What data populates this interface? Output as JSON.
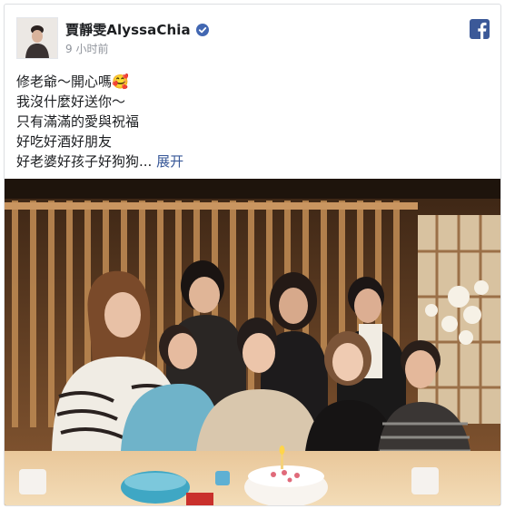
{
  "post": {
    "author": "賈靜雯AlyssaChia",
    "timestamp": "9 小时前",
    "lines": [
      "修老爺～開心嗎🥰",
      "我沒什麼好送你～",
      "只有滿滿的愛與祝福",
      "好吃好酒好朋友",
      "好老婆好孩子好狗狗..."
    ],
    "see_more": "展开",
    "verified_icon": "verified-badge-icon",
    "platform_icon": "facebook-logo-icon"
  },
  "colors": {
    "accent": "#385898",
    "verified": "#4267b2",
    "facebook": "#3b5998",
    "text": "#1c1e21",
    "meta": "#90949c"
  }
}
